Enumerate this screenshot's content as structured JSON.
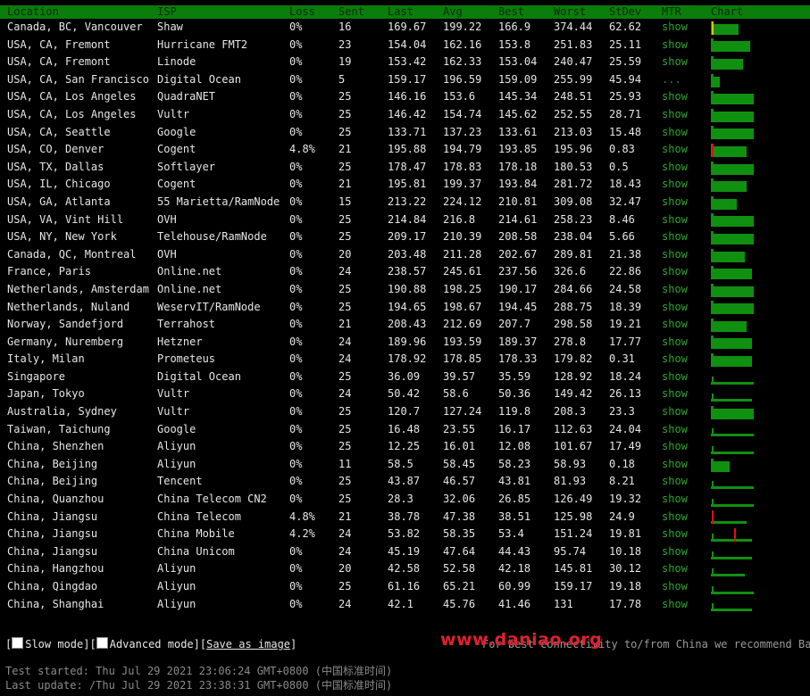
{
  "headers": [
    "Location",
    "ISP",
    "Loss",
    "Sent",
    "Last",
    "Avg",
    "Best",
    "Worst",
    "StDev",
    "MTR",
    "Chart"
  ],
  "rows": [
    {
      "location": "Canada, BC, Vancouver",
      "isp": "Shaw",
      "loss": "0%",
      "sent": "16",
      "last": "169.67",
      "avg": "199.22",
      "best": "166.9",
      "worst": "374.44",
      "stdev": "62.62",
      "mtr": "show",
      "chart": {
        "fill": 0.65,
        "spike": "yellow"
      }
    },
    {
      "location": "USA, CA, Fremont",
      "isp": "Hurricane FMT2",
      "loss": "0%",
      "sent": "23",
      "last": "154.04",
      "avg": "162.16",
      "best": "153.8",
      "worst": "251.83",
      "stdev": "25.11",
      "mtr": "show",
      "chart": {
        "fill": 0.92
      }
    },
    {
      "location": "USA, CA, Fremont",
      "isp": "Linode",
      "loss": "0%",
      "sent": "19",
      "last": "153.42",
      "avg": "162.33",
      "best": "153.04",
      "worst": "240.47",
      "stdev": "25.59",
      "mtr": "show",
      "chart": {
        "fill": 0.76
      }
    },
    {
      "location": "USA, CA, San Francisco",
      "isp": "Digital Ocean",
      "loss": "0%",
      "sent": "5",
      "last": "159.17",
      "avg": "196.59",
      "best": "159.09",
      "worst": "255.99",
      "stdev": "45.94",
      "mtr": "...",
      "chart": {
        "fill": 0.2
      }
    },
    {
      "location": "USA, CA, Los Angeles",
      "isp": "QuadraNET",
      "loss": "0%",
      "sent": "25",
      "last": "146.16",
      "avg": "153.6",
      "best": "145.34",
      "worst": "248.51",
      "stdev": "25.93",
      "mtr": "show",
      "chart": {
        "fill": 1.0
      }
    },
    {
      "location": "USA, CA, Los Angeles",
      "isp": "Vultr",
      "loss": "0%",
      "sent": "25",
      "last": "146.42",
      "avg": "154.74",
      "best": "145.62",
      "worst": "252.55",
      "stdev": "28.71",
      "mtr": "show",
      "chart": {
        "fill": 1.0
      }
    },
    {
      "location": "USA, CA, Seattle",
      "isp": "Google",
      "loss": "0%",
      "sent": "25",
      "last": "133.71",
      "avg": "137.23",
      "best": "133.61",
      "worst": "213.03",
      "stdev": "15.48",
      "mtr": "show",
      "chart": {
        "fill": 1.0
      }
    },
    {
      "location": "USA, CO, Denver",
      "isp": "Cogent",
      "loss": "4.8%",
      "sent": "21",
      "last": "195.88",
      "avg": "194.79",
      "best": "193.85",
      "worst": "195.96",
      "stdev": "0.83",
      "mtr": "show",
      "chart": {
        "fill": 0.84,
        "spike": "red"
      }
    },
    {
      "location": "USA, TX, Dallas",
      "isp": "Softlayer",
      "loss": "0%",
      "sent": "25",
      "last": "178.47",
      "avg": "178.83",
      "best": "178.18",
      "worst": "180.53",
      "stdev": "0.5",
      "mtr": "show",
      "chart": {
        "fill": 1.0
      }
    },
    {
      "location": "USA, IL, Chicago",
      "isp": "Cogent",
      "loss": "0%",
      "sent": "21",
      "last": "195.81",
      "avg": "199.37",
      "best": "193.84",
      "worst": "281.72",
      "stdev": "18.43",
      "mtr": "show",
      "chart": {
        "fill": 0.84
      }
    },
    {
      "location": "USA, GA, Atlanta",
      "isp": "55 Marietta/RamNode",
      "loss": "0%",
      "sent": "15",
      "last": "213.22",
      "avg": "224.12",
      "best": "210.81",
      "worst": "309.08",
      "stdev": "32.47",
      "mtr": "show",
      "chart": {
        "fill": 0.6
      }
    },
    {
      "location": "USA, VA, Vint Hill",
      "isp": "OVH",
      "loss": "0%",
      "sent": "25",
      "last": "214.84",
      "avg": "216.8",
      "best": "214.61",
      "worst": "258.23",
      "stdev": "8.46",
      "mtr": "show",
      "chart": {
        "fill": 1.0
      }
    },
    {
      "location": "USA, NY, New York",
      "isp": "Telehouse/RamNode",
      "loss": "0%",
      "sent": "25",
      "last": "209.17",
      "avg": "210.39",
      "best": "208.58",
      "worst": "238.04",
      "stdev": "5.66",
      "mtr": "show",
      "chart": {
        "fill": 1.0
      }
    },
    {
      "location": "Canada, QC, Montreal",
      "isp": "OVH",
      "loss": "0%",
      "sent": "20",
      "last": "203.48",
      "avg": "211.28",
      "best": "202.67",
      "worst": "289.81",
      "stdev": "21.38",
      "mtr": "show",
      "chart": {
        "fill": 0.8
      }
    },
    {
      "location": "France, Paris",
      "isp": "Online.net",
      "loss": "0%",
      "sent": "24",
      "last": "238.57",
      "avg": "245.61",
      "best": "237.56",
      "worst": "326.6",
      "stdev": "22.86",
      "mtr": "show",
      "chart": {
        "fill": 0.96
      }
    },
    {
      "location": "Netherlands, Amsterdam",
      "isp": "Online.net",
      "loss": "0%",
      "sent": "25",
      "last": "190.88",
      "avg": "198.25",
      "best": "190.17",
      "worst": "284.66",
      "stdev": "24.58",
      "mtr": "show",
      "chart": {
        "fill": 1.0
      }
    },
    {
      "location": "Netherlands, Nuland",
      "isp": "WeservIT/RamNode",
      "loss": "0%",
      "sent": "25",
      "last": "194.65",
      "avg": "198.67",
      "best": "194.45",
      "worst": "288.75",
      "stdev": "18.39",
      "mtr": "show",
      "chart": {
        "fill": 1.0
      }
    },
    {
      "location": "Norway, Sandefjord",
      "isp": "Terrahost",
      "loss": "0%",
      "sent": "21",
      "last": "208.43",
      "avg": "212.69",
      "best": "207.7",
      "worst": "298.58",
      "stdev": "19.21",
      "mtr": "show",
      "chart": {
        "fill": 0.84
      }
    },
    {
      "location": "Germany, Nuremberg",
      "isp": "Hetzner",
      "loss": "0%",
      "sent": "24",
      "last": "189.96",
      "avg": "193.59",
      "best": "189.37",
      "worst": "278.8",
      "stdev": "17.77",
      "mtr": "show",
      "chart": {
        "fill": 0.96
      }
    },
    {
      "location": "Italy, Milan",
      "isp": "Prometeus",
      "loss": "0%",
      "sent": "24",
      "last": "178.92",
      "avg": "178.85",
      "best": "178.33",
      "worst": "179.82",
      "stdev": "0.31",
      "mtr": "show",
      "chart": {
        "fill": 0.96
      }
    },
    {
      "location": "Singapore",
      "isp": "Digital Ocean",
      "loss": "0%",
      "sent": "25",
      "last": "36.09",
      "avg": "39.57",
      "best": "35.59",
      "worst": "128.92",
      "stdev": "18.24",
      "mtr": "show",
      "chart": {
        "fill": 1.0,
        "low": true
      }
    },
    {
      "location": "Japan, Tokyo",
      "isp": "Vultr",
      "loss": "0%",
      "sent": "24",
      "last": "50.42",
      "avg": "58.6",
      "best": "50.36",
      "worst": "149.42",
      "stdev": "26.13",
      "mtr": "show",
      "chart": {
        "fill": 0.96,
        "low": true
      }
    },
    {
      "location": "Australia, Sydney",
      "isp": "Vultr",
      "loss": "0%",
      "sent": "25",
      "last": "120.7",
      "avg": "127.24",
      "best": "119.8",
      "worst": "208.3",
      "stdev": "23.3",
      "mtr": "show",
      "chart": {
        "fill": 1.0
      }
    },
    {
      "location": "Taiwan, Taichung",
      "isp": "Google",
      "loss": "0%",
      "sent": "25",
      "last": "16.48",
      "avg": "23.55",
      "best": "16.17",
      "worst": "112.63",
      "stdev": "24.04",
      "mtr": "show",
      "chart": {
        "fill": 1.0,
        "low": true
      }
    },
    {
      "location": "China, Shenzhen",
      "isp": "Aliyun",
      "loss": "0%",
      "sent": "25",
      "last": "12.25",
      "avg": "16.01",
      "best": "12.08",
      "worst": "101.67",
      "stdev": "17.49",
      "mtr": "show",
      "chart": {
        "fill": 1.0,
        "low": true
      }
    },
    {
      "location": "China, Beijing",
      "isp": "Aliyun",
      "loss": "0%",
      "sent": "11",
      "last": "58.5",
      "avg": "58.45",
      "best": "58.23",
      "worst": "58.93",
      "stdev": "0.18",
      "mtr": "show",
      "chart": {
        "fill": 0.44
      }
    },
    {
      "location": "China, Beijing",
      "isp": "Tencent",
      "loss": "0%",
      "sent": "25",
      "last": "43.87",
      "avg": "46.57",
      "best": "43.81",
      "worst": "81.93",
      "stdev": "8.21",
      "mtr": "show",
      "chart": {
        "fill": 1.0,
        "low": true
      }
    },
    {
      "location": "China, Quanzhou",
      "isp": "China Telecom CN2",
      "loss": "0%",
      "sent": "25",
      "last": "28.3",
      "avg": "32.06",
      "best": "26.85",
      "worst": "126.49",
      "stdev": "19.32",
      "mtr": "show",
      "chart": {
        "fill": 1.0,
        "low": true
      }
    },
    {
      "location": "China, Jiangsu",
      "isp": "China Telecom",
      "loss": "4.8%",
      "sent": "21",
      "last": "38.78",
      "avg": "47.38",
      "best": "38.51",
      "worst": "125.98",
      "stdev": "24.9",
      "mtr": "show",
      "chart": {
        "fill": 0.84,
        "low": true,
        "spike": "red"
      }
    },
    {
      "location": "China, Jiangsu",
      "isp": "China Mobile",
      "loss": "4.2%",
      "sent": "24",
      "last": "53.82",
      "avg": "58.35",
      "best": "53.4",
      "worst": "151.24",
      "stdev": "19.81",
      "mtr": "show",
      "chart": {
        "fill": 0.96,
        "low": true,
        "spike": "red-mid"
      }
    },
    {
      "location": "China, Jiangsu",
      "isp": "China Unicom",
      "loss": "0%",
      "sent": "24",
      "last": "45.19",
      "avg": "47.64",
      "best": "44.43",
      "worst": "95.74",
      "stdev": "10.18",
      "mtr": "show",
      "chart": {
        "fill": 0.96,
        "low": true
      }
    },
    {
      "location": "China, Hangzhou",
      "isp": "Aliyun",
      "loss": "0%",
      "sent": "20",
      "last": "42.58",
      "avg": "52.58",
      "best": "42.18",
      "worst": "145.81",
      "stdev": "30.12",
      "mtr": "show",
      "chart": {
        "fill": 0.8,
        "low": true
      }
    },
    {
      "location": "China, Qingdao",
      "isp": "Aliyun",
      "loss": "0%",
      "sent": "25",
      "last": "61.16",
      "avg": "65.21",
      "best": "60.99",
      "worst": "159.17",
      "stdev": "19.18",
      "mtr": "show",
      "chart": {
        "fill": 1.0,
        "low": true
      }
    },
    {
      "location": "China, Shanghai",
      "isp": "Aliyun",
      "loss": "0%",
      "sent": "24",
      "last": "42.1",
      "avg": "45.76",
      "best": "41.46",
      "worst": "131",
      "stdev": "17.78",
      "mtr": "show",
      "chart": {
        "fill": 0.96,
        "low": true
      }
    }
  ],
  "controls": {
    "open_bracket": "[",
    "slow_mode_label": "Slow mode",
    "mid_bracket": "][",
    "advanced_mode_label": "Advanced mode",
    "save_label": "Save as image",
    "close_bracket": "]"
  },
  "note": "For best connectivity to/from China we recommend Ban",
  "watermark": "www.daniao.org",
  "test_started": "Test started: Thu Jul 29 2021 23:06:24 GMT+0800 (中国标准时间)",
  "last_update": "Last update: /Thu Jul 29 2021 23:38:31 GMT+0800 (中国标准时间)",
  "colors": {
    "header_bg": "#0a7d0a",
    "chart_green": "#109010",
    "spike_red": "#e01010",
    "spike_yellow": "#e0c010"
  }
}
